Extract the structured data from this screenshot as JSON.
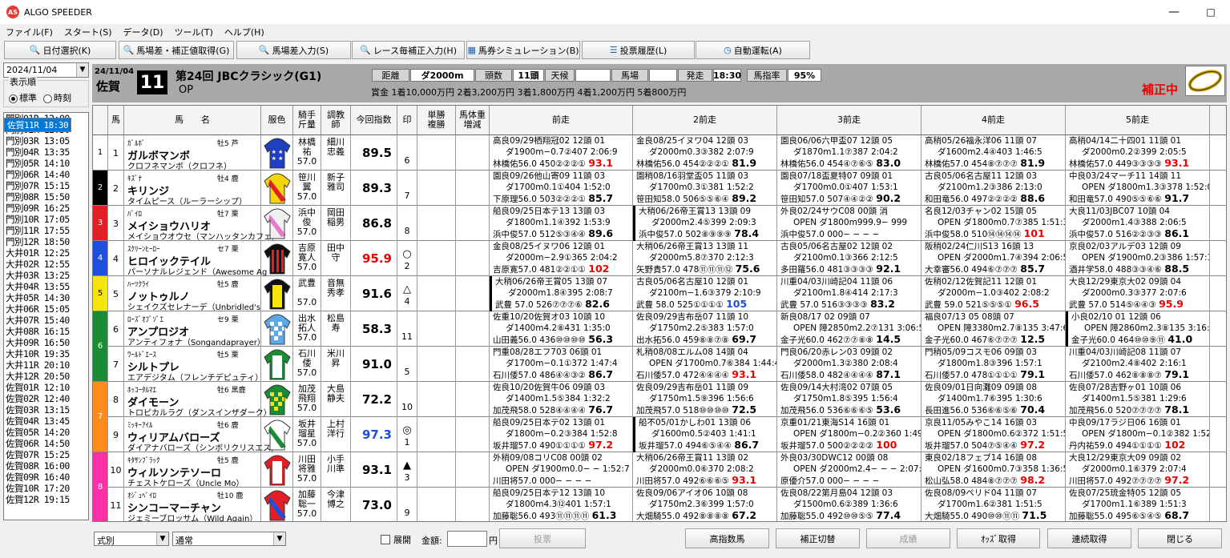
{
  "app": {
    "title": "ALGO SPEEDER",
    "logo": "AS"
  },
  "menu": [
    "ファイル(F)",
    "スタート(S)",
    "データ(D)",
    "ツール(T)",
    "ヘルプ(H)"
  ],
  "toolbar": [
    {
      "label": "日付選択(K)",
      "icon": "search-icon"
    },
    {
      "label": "馬場差・補正値取得(G)",
      "icon": "search-icon"
    },
    {
      "label": "馬場差入力(S)",
      "icon": "search-icon"
    },
    {
      "label": "レース毎補正入力(H)",
      "icon": "search-icon"
    },
    {
      "label": "馬券シミュレーション(B)",
      "icon": "table-icon"
    },
    {
      "label": "投票履歴(L)",
      "icon": "document-icon"
    },
    {
      "label": "自動運転(A)",
      "icon": "clock-icon"
    }
  ],
  "left": {
    "date": "2024/11/04",
    "sort_title": "表示順",
    "sort_opts": [
      "標準",
      "時刻"
    ],
    "sort_sel": 0,
    "races": [
      "門別01R 12:00",
      "門別02R 12:30",
      "門別03R 13:05",
      "門別04R 13:35",
      "門別05R 14:10",
      "門別06R 14:40",
      "門別07R 15:15",
      "門別08R 15:50",
      "門別09R 16:25",
      "門別10R 17:05",
      "門別11R 17:55",
      "門別12R 18:50",
      "大井01R 12:25",
      "大井02R 12:55",
      "大井03R 13:25",
      "大井04R 13:55",
      "大井05R 14:30",
      "大井06R 15:05",
      "大井07R 15:40",
      "大井08R 16:15",
      "大井09R 16:50",
      "大井10R 19:35",
      "大井11R 20:10",
      "大井12R 20:50",
      "佐賀01R 12:10",
      "佐賀02R 12:40",
      "佐賀03R 13:15",
      "佐賀04R 13:45",
      "佐賀05R 14:20",
      "佐賀06R 14:50",
      "佐賀07R 15:25",
      "佐賀08R 16:00",
      "佐賀09R 16:40",
      "佐賀10R 17:20",
      "佐賀11R 18:30",
      "佐賀12R 19:15"
    ],
    "selected": 34
  },
  "race": {
    "date": "24/11/04",
    "venue": "佐賀",
    "num": "11",
    "name": "第24回 JBCクラシック(G1)",
    "grade": "OP",
    "boxes": [
      [
        "距離",
        "l"
      ],
      [
        "ダ2000m",
        "v"
      ],
      [
        "頭数",
        "l"
      ],
      [
        "11頭",
        "v"
      ],
      [
        "天候",
        "l"
      ],
      [
        "",
        "v"
      ],
      [
        "馬場",
        "l"
      ],
      [
        "",
        "v"
      ],
      [
        "発走",
        "l"
      ],
      [
        "18:30",
        "v"
      ],
      [
        "馬指率",
        "l"
      ],
      [
        "95%",
        "v"
      ]
    ],
    "prize": "賞金 1着10,000万円 2着3,200万円 3着1,800万円 4着1,200万円 5着800万円",
    "status": "補正中"
  },
  "headers": [
    "",
    "馬",
    "馬　　名",
    "服色",
    "騎手\n斤量",
    "調教\n師",
    "今回指数",
    "印",
    "単勝\n複勝",
    "馬体重\n増減",
    "前走",
    "2前走",
    "3前走",
    "4前走",
    "5前走"
  ],
  "waku_colors": [
    "#ffffff",
    "#000000",
    "#e31e24",
    "#1e4fdc",
    "#f5e50a",
    "#1a8c35",
    "#ff8c1a",
    "#ff2fa8"
  ],
  "horses": [
    {
      "w": 1,
      "u": "1",
      "sire": "ｶﾞﾙﾎﾞ",
      "sex": "牡5 芦",
      "name": "ガルボマンボ",
      "dam": "クロフネマンボ（クロフネ）",
      "jk": "林橋\n祐\n57.0",
      "tr": "細川\n忠義",
      "idx": "89.5",
      "idxc": "#000",
      "mk": "",
      "pop": "6",
      "silk": [
        "#1e40c0",
        "#ffffff",
        "star"
      ],
      "p": [
        [
          "高良09/29栖翔冠02 12頭 01",
          "ダ1900m−0.7②407 2:06:9",
          "林橋佑56.0 450②②②① ",
          "93.1",
          "#e00",
          0
        ],
        [
          "金良08/25イヌワ04 12頭 03",
          "ダ2000m0.3③382 2:07:9",
          "林橋佑56.0 454②②②① ",
          "81.9",
          "#000",
          0
        ],
        [
          "園良06/06六甲盃07 12頭 05",
          "ダ1870m1.1⑦387 2:04:2",
          "林橋佑56.0 454④⑦⑥⑤ ",
          "83.0",
          "#000",
          0
        ],
        [
          "高稍05/26福永洋06 11頭 07",
          "ダ1600m2.4④403 1:46:5",
          "林橋佑57.0 454⑧⑦⑦⑦ ",
          "81.9",
          "#000",
          0
        ],
        [
          "高稍04/14二十四01 11頭 01",
          "ダ2000m0.2②399 2:05:5",
          "林橋佑57.0 449③③③③ ",
          "93.1",
          "#e00",
          0
        ]
      ]
    },
    {
      "w": 2,
      "u": "2",
      "sire": "ｷｽﾞﾅ",
      "sex": "牡4 鹿",
      "name": "キリンジ",
      "dam": "タイムピース（ルーラーシップ）",
      "jk": "笹川\n翼\n57.0",
      "tr": "新子\n雅司",
      "idx": "89.3",
      "idxc": "#000",
      "mk": "",
      "pop": "7",
      "silk": [
        "#f5d60a",
        "#e31e24",
        "sash"
      ],
      "p": [
        [
          "園良09/26他山寄09 11頭 03",
          "ダ1700m0.1①404 1:52:0",
          "下原理56.0 503②②②① ",
          "85.7",
          "#000",
          0
        ],
        [
          "園稍08/16羽堂盃05 11頭 03",
          "ダ1700m0.3①381 1:52:2",
          "笹田知58.0 506⑤⑤⑥④ ",
          "89.2",
          "#000",
          0
        ],
        [
          "園良07/18盃夏特07 09頭 01",
          "ダ1700m0.0①407 1:53:1",
          "笹田知57.0 507④④②② ",
          "90.2",
          "#000",
          0
        ],
        [
          "古良05/06名古屋11 12頭 03",
          "ダ2100m1.2③386 2:13:0",
          "和田竜56.0 497②②②② ",
          "88.6",
          "#000",
          0
        ],
        [
          "中良03/24マーチ11 14頭 11",
          "OPEN ダ1800m1.3③378 1:52:0",
          "和田竜57.0 490⑤⑤⑥⑥ ",
          "91.7",
          "#000",
          0
        ]
      ]
    },
    {
      "w": 3,
      "u": "3",
      "sire": "ﾊﾟｲﾛ",
      "sex": "牡7 栗",
      "name": "メイショウハリオ",
      "dam": "メイショウオウセ（マンハッタンカフェ）",
      "jk": "浜中\n俊\n57.0",
      "tr": "岡田\n稲男",
      "idx": "86.8",
      "idxc": "#000",
      "mk": "",
      "pop": "8",
      "silk": [
        "#f0f0f0",
        "#e879c8",
        "sash"
      ],
      "p": [
        [
          "船良09/25日本テ13 13頭 03",
          "ダ1800m1.1④392 1:53:9",
          "浜中俊57.0 512⑤③④④ ",
          "89.6",
          "#000",
          0
        ],
        [
          "大稍06/26帝王賞13 13頭 09",
          "ダ2000m2.4⑤399 2:09:3",
          "浜中俊57.0 502⑧⑨⑨⑨ ",
          "78.4",
          "#000",
          1
        ],
        [
          "外良02/24サウC08 00頭 消",
          "OPEN ダ1800m999.9− 999",
          "浜中俊57.0 000− − − − ",
          "",
          "#000",
          0
        ],
        [
          "名良12/03チャン02 15頭 05",
          "OPEN ダ1800m0.7⑦385 1:51:3",
          "浜中俊58.0 510⑭⑭⑭⑭ ",
          "101",
          "#e00",
          0
        ],
        [
          "大良11/03JBC07 10頭 04",
          "ダ2000m1.4③388 2:06:5",
          "浜中俊57.0 516②②③③ ",
          "86.1",
          "#000",
          0
        ]
      ]
    },
    {
      "w": 4,
      "u": "4",
      "sire": "ｽｸﾘｰﾝﾋｰﾛｰ",
      "sex": "セ7 栗",
      "name": "ヒロイックテイル",
      "dam": "パーソナルレジェンド（Awesome Ag",
      "jk": "吉原\n寛人\n57.0",
      "tr": "田中\n守",
      "idx": "95.9",
      "idxc": "#e00",
      "mk": "○",
      "pop": "2",
      "silk": [
        "#111111",
        "#e31e24",
        "stripe"
      ],
      "p": [
        [
          "金良08/25イヌワ06 12頭 01",
          "ダ2000m−2.9①365 2:04:2",
          "吉原寛57.0 481②②①① ",
          "102",
          "#e00",
          0
        ],
        [
          "大稍06/26帝王賞13 13頭 11",
          "ダ2000m5.8⑦370 2:12:3",
          "矢野貴57.0 478⑪⑪⑪⑫ ",
          "75.6",
          "#000",
          0
        ],
        [
          "古良05/06名古屋02 12頭 02",
          "ダ2100m0.1③366 2:12:5",
          "多田羅56.0 481③③③③ ",
          "92.1",
          "#000",
          0
        ],
        [
          "阪稍02/24仁川S13 16頭 13",
          "OPEN ダ2000m1.7④394 2:06:5",
          "大幸審56.0 494⑥⑦⑦⑦ ",
          "85.7",
          "#000",
          0
        ],
        [
          "京良02/03アルデ03 12頭 09",
          "OPEN ダ1900m0.2③386 1:57:1",
          "酒井学58.0 488③③④⑥ ",
          "88.5",
          "#000",
          0
        ]
      ]
    },
    {
      "w": 5,
      "u": "5",
      "sire": "ﾊｰﾂｸﾗｲ",
      "sex": "牡5 鹿",
      "name": "ノットゥルノ",
      "dam": "シェイクズセレナーデ（Unbridled's",
      "jk": "武豊\n\n57.0",
      "tr": "音無\n秀孝",
      "idx": "91.6",
      "idxc": "#000",
      "mk": "△",
      "pop": "4",
      "silk": [
        "#111111",
        "#f5e50a",
        "vest"
      ],
      "p": [
        [
          "大稍06/26帝王賞05 13頭 07",
          "ダ2000m1.8④395 2:08:7",
          "武豊 57.0 526⑦⑦⑦⑥ ",
          "82.6",
          "#000",
          1
        ],
        [
          "古良05/06名古屋10 12頭 01",
          "ダ2100m−1.6③379 2:10:9",
          "武豊 58.0 525①①①① ",
          "105",
          "#1e4fdc",
          0
        ],
        [
          "川重04/03川崎記04 11頭 06",
          "ダ2100m1.8④414 2:17:3",
          "武豊 57.0 516③③③③ ",
          "83.2",
          "#000",
          0
        ],
        [
          "佐稍02/12佐賀記11 12頭 01",
          "ダ2000m−1.0③402 2:08:2",
          "武豊 59.0 521⑤⑤⑤① ",
          "96.5",
          "#e00",
          0
        ],
        [
          "大良12/29東京大02 09頭 04",
          "ダ2000m0.3③377 2:07:6",
          "武豊 57.0 514⑤④④③ ",
          "95.9",
          "#e00",
          0
        ]
      ]
    },
    {
      "w": 6,
      "u": "6",
      "sire": "ﾛｰｽﾞｵﾌﾞｿﾞｴ",
      "sex": "セ9 栗",
      "name": "アンプロジオ",
      "dam": "アンティフォナ（Songandaprayer）",
      "jk": "出水\n拓人\n57.0",
      "tr": "松島\n寿",
      "idx": "58.3",
      "idxc": "#000",
      "mk": "",
      "pop": "11",
      "silk": [
        "#5fa8e8",
        "#ffffff",
        "check"
      ],
      "p": [
        [
          "佐重10/20佐賀オ03 10頭 10",
          "ダ1400m4.2⑧431 1:35:0",
          "山田義56.0 436⑩⑩⑩⑩ ",
          "56.3",
          "#000",
          0
        ],
        [
          "佐良09/29吉布岳07 11頭 10",
          "ダ1750m2.2⑤383 1:57:0",
          "出水拓56.0 459⑧⑧⑦⑧ ",
          "69.7",
          "#000",
          0
        ],
        [
          "新良08/17 02 09頭 07",
          "OPEN 障2850m2.2⑦131 3:06:5",
          "金子光60.0 462⑦⑦⑧⑧ ",
          "14.5",
          "#000",
          0
        ],
        [
          "福良07/13 05 08頭 07",
          "OPEN 障3380m2.7⑧135 3:47:6",
          "金子光60.0 467⑥⑦⑦⑦ ",
          "12.5",
          "#000",
          0
        ],
        [
          "小良02/10 01 12頭 06",
          "OPEN 障2860m2.3⑧135 3:16:6",
          "金子光60.0 464⑩⑩⑨⑪ ",
          "41.0",
          "#000",
          1
        ]
      ]
    },
    {
      "w": 6,
      "u": "7",
      "sire": "ﾜｰﾙﾄﾞｴｰｽ",
      "sex": "牡5 栗",
      "name": "シルトプレ",
      "dam": "エアデジタム（フレンチデピュティ）",
      "jk": "石川\n倭\n57.0",
      "tr": "米川\n昇",
      "idx": "91.0",
      "idxc": "#000",
      "mk": "",
      "pop": "5",
      "silk": [
        "#1a8c35",
        "#ffffff",
        "vest"
      ],
      "p": [
        [
          "門重08/28エフ703 06頭 01",
          "ダ1700m−0.1①372 1:47:4",
          "石川倭57.0 486④④③② ",
          "86.7",
          "#000",
          0
        ],
        [
          "札稍08/08エルム08 14頭 04",
          "OPEN ダ1700m0.7⑥384 1:44:4",
          "石川倭57.0 472④④④④ ",
          "93.1",
          "#e00",
          0
        ],
        [
          "門良06/20赤レン03 09頭 02",
          "ダ2000m1.3②380 2:08:4",
          "石川倭58.0 482④④④④ ",
          "87.1",
          "#000",
          0
        ],
        [
          "門稍05/09コスモ06 09頭 03",
          "ダ1800m1.8③396 1:57:1",
          "石川倭57.0 478①①①① ",
          "79.1",
          "#000",
          0
        ],
        [
          "川重04/03川崎記08 11頭 07",
          "ダ2100m2.4⑧402 2:16:1",
          "石川倭57.0 462⑧⑧⑧⑦ ",
          "79.1",
          "#000",
          0
        ]
      ]
    },
    {
      "w": 7,
      "u": "8",
      "sire": "ﾎｯｺｰﾀﾙﾏｴ",
      "sex": "牡6 黒鹿",
      "name": "ダイモーン",
      "dam": "トロピカルラグ（ダンスインザダーク）",
      "jk": "加茂\n飛翔\n57.0",
      "tr": "大島\n静夫",
      "idx": "72.2",
      "idxc": "#000",
      "mk": "",
      "pop": "10",
      "silk": [
        "#1a8c35",
        "#f5e50a",
        "check"
      ],
      "p": [
        [
          "佐良10/20佐賀牛06 09頭 03",
          "ダ1400m1.5⑤384 1:32:2",
          "加茂飛58.0 528④④④④ ",
          "76.7",
          "#000",
          0
        ],
        [
          "佐良09/29吉布岳01 11頭 09",
          "ダ1750m1.5⑨396 1:56:6",
          "加茂飛57.0 518⑩⑩⑩⑩ ",
          "72.5",
          "#000",
          0
        ],
        [
          "佐良09/14大村湾02 07頭 05",
          "ダ1750m1.8⑤395 1:56:4",
          "加茂飛56.0 536⑥⑥⑥⑤ ",
          "53.6",
          "#000",
          0
        ],
        [
          "佐良09/01日向灘09 09頭 08",
          "ダ1400m1.7⑥395 1:30:6",
          "長田進56.0 536⑥⑥⑤⑥ ",
          "70.4",
          "#000",
          0
        ],
        [
          "佐良07/28吉野ヶ01 10頭 06",
          "ダ1400m1.5⑤381 1:29:6",
          "加茂飛56.0 520⑦⑦⑦⑦ ",
          "78.1",
          "#000",
          0
        ]
      ]
    },
    {
      "w": 7,
      "u": "9",
      "sire": "ﾐｯｷｰｱｲﾙ",
      "sex": "牡6 鹿",
      "name": "ウィリアムバローズ",
      "dam": "ダイアナバローズ（シンボリクリスエス）",
      "jk": "坂井\n瑠星\n57.0",
      "tr": "上村\n洋行",
      "idx": "97.3",
      "idxc": "#1e4fdc",
      "mk": "◎",
      "pop": "1",
      "silk": [
        "#ffffff",
        "#1a8c35",
        "sash"
      ],
      "p": [
        [
          "船良09/25日本テ02 13頭 01",
          "ダ1800m−0.2③384 1:52:8",
          "坂井瑠57.0 490①①①① ",
          "97.2",
          "#e00",
          0
        ],
        [
          "船不05/01かしわ01 13頭 06",
          "ダ1600m0.5②403 1:41:1",
          "坂井瑠57.0 494⑥⑤④④ ",
          "86.7",
          "#000",
          1
        ],
        [
          "京重01/21東海S14 16頭 01",
          "OPEN ダ1800m−0.2②360 1:49:2",
          "坂井瑠57.0 500②②②② ",
          "100",
          "#e00",
          0
        ],
        [
          "京良11/05みやこ14 16頭 03",
          "OPEN ダ1800m0.6②372 1:51:5",
          "坂井瑠57.0 504⑦⑤④④ ",
          "97.2",
          "#e00",
          0
        ],
        [
          "中良09/17ラジ日06 16頭 01",
          "OPEN ダ1800m−0.1②382 1:52:0",
          "丹内祐59.0 494①①①① ",
          "102",
          "#e00",
          0
        ]
      ]
    },
    {
      "w": 8,
      "u": "10",
      "sire": "ｷﾀｻﾝﾌﾞﾗｯｸ",
      "sex": "牡5 鹿",
      "name": "ウィルソンテソーロ",
      "dam": "チェストケローズ（Uncle Mo）",
      "jk": "川田\n将雅\n57.0",
      "tr": "小手\n川準",
      "idx": "93.1",
      "idxc": "#000",
      "mk": "▲",
      "pop": "3",
      "silk": [
        "#e31e24",
        "#ffffff",
        "vest"
      ],
      "p": [
        [
          "外稍09/08コリC08 00頭 02",
          "OPEN ダ1900m0.0− − 1:52:7",
          "川田将57.0 000− − − − ",
          "",
          "#000",
          0
        ],
        [
          "大稍06/26帝王賞11 13頭 02",
          "ダ2000m0.0⑥370 2:08:2",
          "川田将57.0 492⑥⑥⑥⑤ ",
          "93.1",
          "#e00",
          0
        ],
        [
          "外良03/30DWC12 00頭 08",
          "OPEN ダ2000m2.4− − − 2:07:0",
          "原優介57.0 000− − − − ",
          "",
          "#000",
          0
        ],
        [
          "東良02/18フェブ14 16頭 08",
          "OPEN ダ1600m0.7③358 1:36:5",
          "松山弘58.0 484⑧⑦⑦⑦ ",
          "98.2",
          "#e00",
          0
        ],
        [
          "大良12/29東京大09 09頭 02",
          "ダ2000m0.1⑥379 2:07:4",
          "川田将57.0 492⑦⑦⑦⑦ ",
          "97.2",
          "#e00",
          0
        ]
      ]
    },
    {
      "w": 8,
      "u": "11",
      "sire": "ｵｼﾞｭﾍﾟｲﾛ",
      "sex": "牡10 鹿",
      "name": "シンコーマーチャン",
      "dam": "ジェミーブロッサム（Wild Again）",
      "jk": "加藤\n聡一\n57.0",
      "tr": "今津\n博之",
      "idx": "73.0",
      "idxc": "#000",
      "mk": "",
      "pop": "9",
      "silk": [
        "#e31e24",
        "#1e4fdc",
        "sash"
      ],
      "p": [
        [
          "船良09/25日本テ12 13頭 10",
          "ダ1800m4.3⑫401 1:57:1",
          "加藤聡56.0 493⑪⑪⑪⑪ ",
          "61.3",
          "#000",
          0
        ],
        [
          "佐良09/06アイオ06 10頭 08",
          "ダ1750m2.3⑥399 1:57:0",
          "大畑騎55.0 492⑧⑧⑧⑧ ",
          "67.2",
          "#000",
          0
        ],
        [
          "佐良08/22第月島04 12頭 03",
          "ダ1500m0.6②389 1:36:6",
          "加藤聡55.0 492⑩⑩⑤⑤ ",
          "77.4",
          "#000",
          0
        ],
        [
          "佐良08/09ペリド04 11頭 07",
          "ダ1700m1.6②381 1:51:5",
          "大畑騎55.0 490⑩⑩⑪⑪ ",
          "71.5",
          "#000",
          0
        ],
        [
          "佐良07/25琉金特05 12頭 05",
          "ダ1700m1.1⑥389 1:51:3",
          "加藤聡55.0 495⑥⑤④⑤ ",
          "68.7",
          "#000",
          0
        ]
      ]
    }
  ],
  "bottom": {
    "bet_type": "式別",
    "mode": "通常",
    "expand": "展開",
    "amount_label": "金額:",
    "amount": "",
    "yen": "円",
    "vote": "投票",
    "buttons": [
      "高指数馬",
      "補正切替",
      "成績",
      "ｵｯｽﾞ取得",
      "連続取得",
      "閉じる"
    ]
  }
}
